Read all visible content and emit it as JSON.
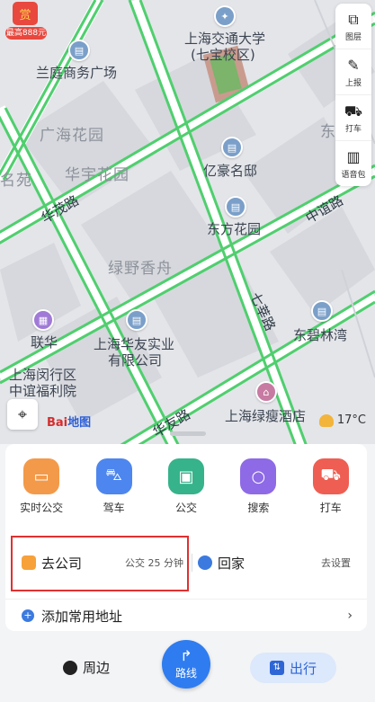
{
  "badge": {
    "symbol": "赏",
    "tag": "最高888元"
  },
  "tools": [
    {
      "icon": "layers-icon",
      "glyph": "⧉",
      "label": "图层"
    },
    {
      "icon": "report-icon",
      "glyph": "✎",
      "label": "上报"
    },
    {
      "icon": "taxi-icon",
      "glyph": "⛟",
      "label": "打车"
    },
    {
      "icon": "voice-pack-icon",
      "glyph": "▥",
      "label": "语音包"
    }
  ],
  "map_labels": {
    "sjtu": "上海交通大学",
    "sjtu_sub": "(七宝校区)",
    "lanting": "兰庭商务广场",
    "guanghai": "广海花园",
    "huayu": "华宇花园",
    "yihao": "亿豪名邸",
    "dongfang": "东方花园",
    "lvye": "绿野香舟",
    "huamao": "华茂路",
    "zhongyi": "中谊路",
    "qixin": "七莘路",
    "lianhua": "联华",
    "huayou": "上海华友实业",
    "huayou2": "有限公司",
    "dongbi": "东碧林湾",
    "minhang": "上海闵行区",
    "minhang2": "中谊福利院",
    "huayoulu": "华友路",
    "lvshou": "上海绿瘦酒店",
    "mingyuan": "名苑",
    "dong_edge": "东"
  },
  "map_brand": {
    "name": "Bai",
    "suffix": "地图"
  },
  "weather": {
    "temp": "17°C"
  },
  "quick": [
    {
      "label": "实时公交",
      "color": "#f39a4a",
      "glyph": "▭"
    },
    {
      "label": "驾车",
      "color": "#4d86ee",
      "glyph": "⛍"
    },
    {
      "label": "公交",
      "color": "#36b38b",
      "glyph": "▣"
    },
    {
      "label": "搜索",
      "color": "#8e6ae6",
      "glyph": "○"
    },
    {
      "label": "打车",
      "color": "#ef5e52",
      "glyph": "⛟"
    }
  ],
  "company": {
    "label": "去公司",
    "sub": "公交 25 分钟"
  },
  "home": {
    "label": "回家",
    "sub": "去设置"
  },
  "add_address": {
    "label": "添加常用地址",
    "chev": "›"
  },
  "bottom": {
    "nearby": "周边",
    "route": "路线",
    "go": "出行"
  }
}
